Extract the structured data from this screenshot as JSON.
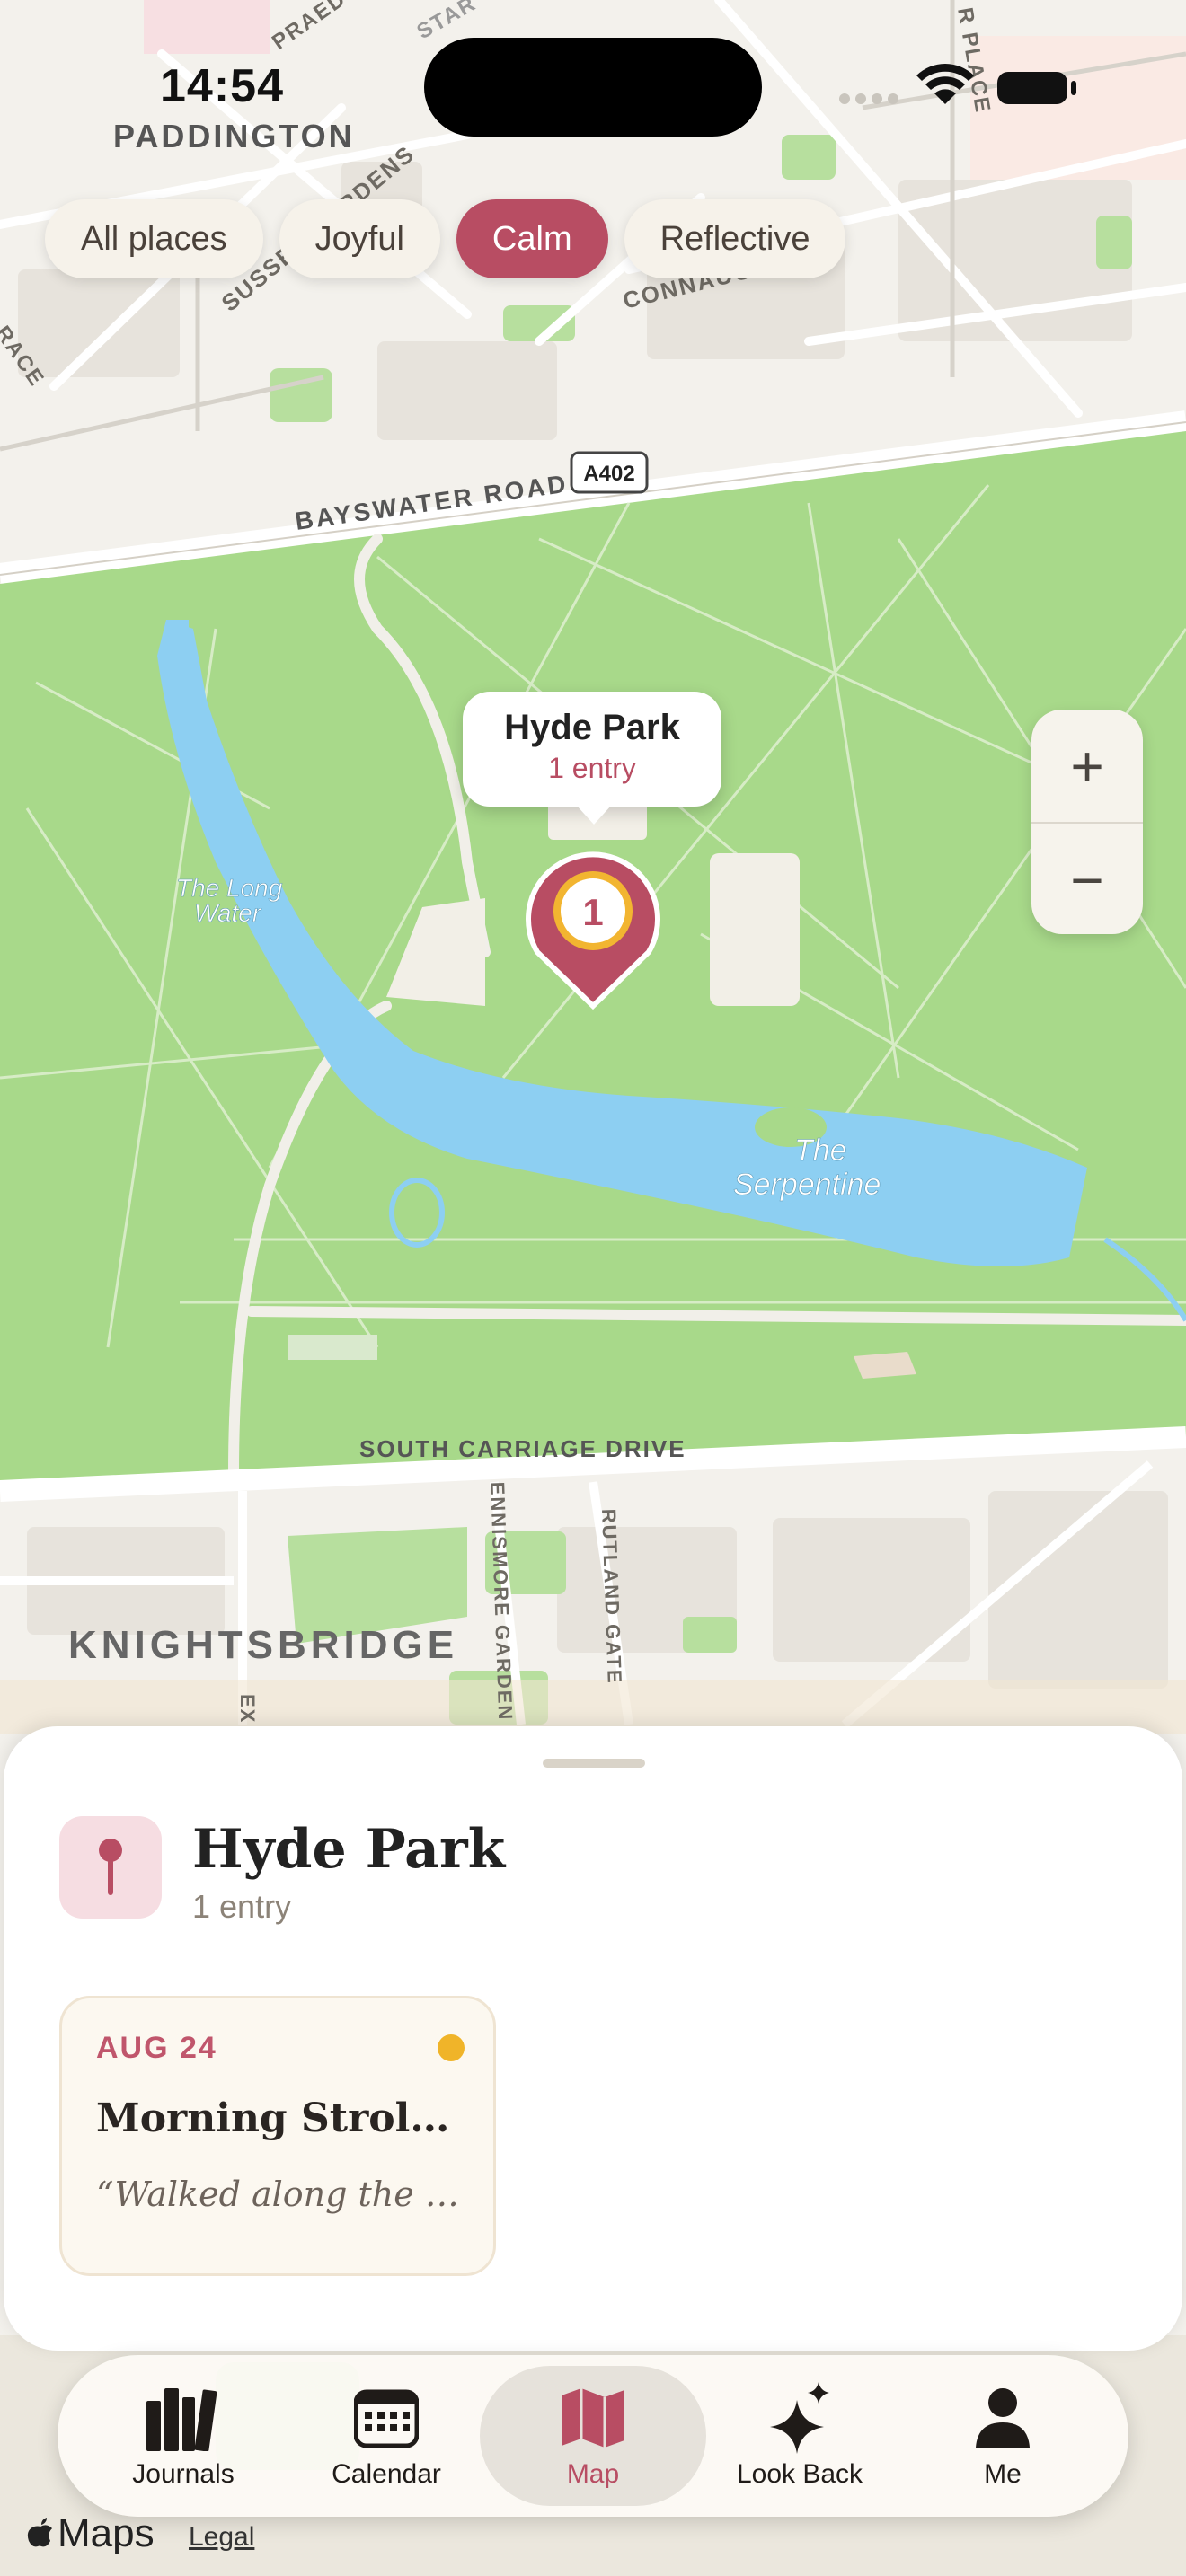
{
  "status_bar": {
    "time": "14:54"
  },
  "map_labels": {
    "paddington": "PADDINGTON",
    "praed": "PRAED S",
    "sussex_gardens": "SUSSEX GARDENS",
    "connaught": "CONNAUG",
    "bayswater": "BAYSWATER ROAD",
    "a402": "A402",
    "long_water_1": "The Long",
    "long_water_2": "Water",
    "serpentine_1": "The",
    "serpentine_2": "Serpentine",
    "south_carriage": "SOUTH CARRIAGE DRIVE",
    "ennismore": "ENNISMORE GARDEN",
    "rutland": "RUTLAND GATE",
    "knightsbridge": "KNIGHTSBRIDGE",
    "race": "RACE",
    "star": "STAR",
    "place_top": "R PLACE",
    "ex": "EX"
  },
  "filters": [
    {
      "label": "All places",
      "active": false
    },
    {
      "label": "Joyful",
      "active": false
    },
    {
      "label": "Calm",
      "active": true
    },
    {
      "label": "Reflective",
      "active": false
    }
  ],
  "pin": {
    "count": "1",
    "color": "#b84d63"
  },
  "callout": {
    "title": "Hyde Park",
    "subtitle": "1 entry"
  },
  "zoom": {
    "in": "+",
    "out": "−"
  },
  "sheet": {
    "place_name": "Hyde Park",
    "entry_count": "1 entry",
    "entries": [
      {
        "date": "AUG 24",
        "title": "Morning Stroll a…",
        "quote": "“Walked along the w…",
        "mood_color": "#f0b429"
      }
    ]
  },
  "tabs": [
    {
      "label": "Journals",
      "icon": "books-icon",
      "active": false
    },
    {
      "label": "Calendar",
      "icon": "calendar-icon",
      "active": false
    },
    {
      "label": "Map",
      "icon": "map-icon",
      "active": true
    },
    {
      "label": "Look Back",
      "icon": "sparkles-icon",
      "active": false
    },
    {
      "label": "Me",
      "icon": "person-icon",
      "active": false
    }
  ],
  "attribution": {
    "maps": "Maps",
    "legal": "Legal"
  },
  "colors": {
    "accent": "#b84d63",
    "park": "#a8d98a",
    "water": "#8dcff2"
  }
}
